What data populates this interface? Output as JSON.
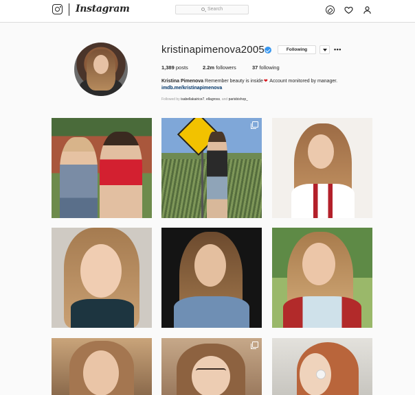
{
  "nav": {
    "wordmark": "Instagram",
    "search_placeholder": "Search"
  },
  "profile": {
    "username": "kristinapimenova2005",
    "following_button": "Following",
    "more_glyph": "•••",
    "stats": {
      "posts_count": "1,389",
      "posts_label": "posts",
      "followers_count": "2.2m",
      "followers_label": "followers",
      "following_count": "37",
      "following_label": "following"
    },
    "bio_name": "Kristina Pimenova",
    "bio_text_1": "Remember beauty is inside",
    "bio_heart": "❤",
    "bio_text_2": "Account monitored by manager.",
    "link": "imdb.me/kristinapimenova",
    "followed_by_prefix": "Followed by",
    "followed_by_user_1": "isabellakairice7",
    "followed_by_sep_1": ",",
    "followed_by_user_2": "ellagross",
    "followed_by_sep_2": ", and",
    "followed_by_user_3": "parisbishop_"
  },
  "grid": {
    "posts": [
      {
        "multi": false
      },
      {
        "multi": true
      },
      {
        "multi": false
      },
      {
        "multi": false
      },
      {
        "multi": false
      },
      {
        "multi": false
      },
      {
        "multi": false
      },
      {
        "multi": true
      },
      {
        "multi": false
      }
    ]
  },
  "colors": {
    "accent": "#3897f0",
    "link": "#003569",
    "heart": "#d7141b"
  }
}
